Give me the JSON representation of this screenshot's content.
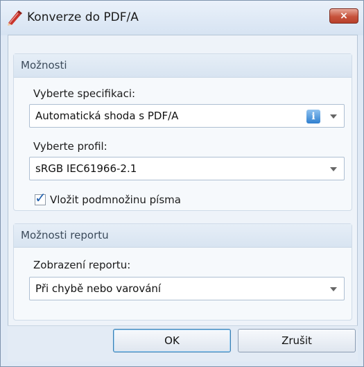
{
  "window": {
    "title": "Konverze do PDF/A",
    "close_symbol": "×",
    "icon": "pdf-pen-icon"
  },
  "options_group": {
    "header": "Možnosti",
    "spec_label": "Vyberte specifikaci:",
    "spec_value": "Automatická shoda s PDF/A",
    "info_symbol": "i",
    "profile_label": "Vyberte profil:",
    "profile_value": "sRGB IEC61966-2.1",
    "embed_font_label": "Vložit podmnožinu písma",
    "embed_font_checked": true
  },
  "report_group": {
    "header": "Možnosti reportu",
    "display_label": "Zobrazení reportu:",
    "display_value": "Při chybě nebo varování"
  },
  "buttons": {
    "ok": "OK",
    "cancel": "Zrušit"
  }
}
